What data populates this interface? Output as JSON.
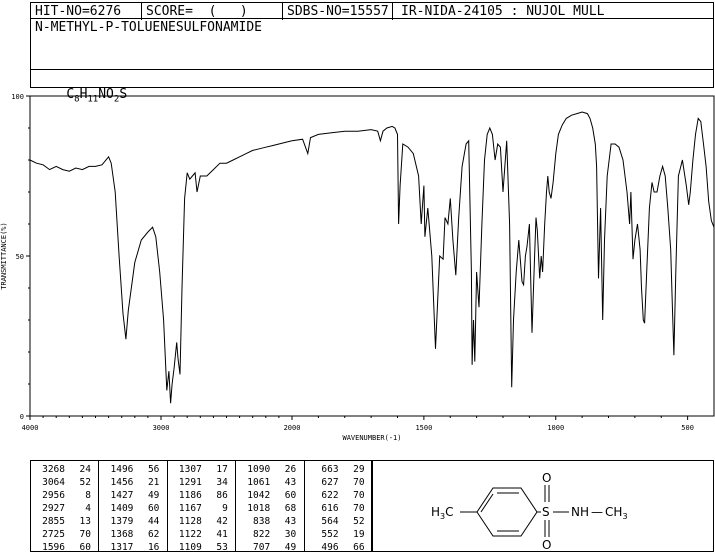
{
  "header": {
    "hit_no": "HIT-NO=6276",
    "score": "SCORE=  (   )",
    "sdbs_no": "SDBS-NO=15557",
    "ir_info": "IR-NIDA-24105 : NUJOL MULL",
    "compound_name": "N-METHYL-P-TOLUENESULFONAMIDE",
    "formula_parts": [
      "C",
      "8",
      "H",
      "11",
      "NO",
      "2",
      "S"
    ]
  },
  "chart_data": {
    "type": "line",
    "title": "",
    "xlabel": "WAVENUMBER(-1)",
    "ylabel": "TRANSMITTANCE(%)",
    "xlim": [
      4000,
      400
    ],
    "ylim": [
      0,
      100
    ],
    "x_ticks": [
      "4000",
      "3000",
      "2000",
      "1500",
      "1000",
      "500"
    ],
    "y_ticks": [
      "100",
      "50",
      "0"
    ],
    "grid": false,
    "series": [
      {
        "name": "",
        "points": [
          [
            4000,
            80
          ],
          [
            3950,
            79
          ],
          [
            3900,
            78.5
          ],
          [
            3850,
            77
          ],
          [
            3800,
            78
          ],
          [
            3750,
            77
          ],
          [
            3700,
            76.5
          ],
          [
            3650,
            77.5
          ],
          [
            3600,
            77
          ],
          [
            3550,
            78
          ],
          [
            3500,
            78
          ],
          [
            3450,
            78.5
          ],
          [
            3400,
            81
          ],
          [
            3380,
            79
          ],
          [
            3350,
            70
          ],
          [
            3320,
            50
          ],
          [
            3290,
            32
          ],
          [
            3268,
            24
          ],
          [
            3250,
            33
          ],
          [
            3200,
            48
          ],
          [
            3150,
            55
          ],
          [
            3100,
            57.5
          ],
          [
            3064,
            59
          ],
          [
            3040,
            56
          ],
          [
            3010,
            45
          ],
          [
            2980,
            30
          ],
          [
            2956,
            8
          ],
          [
            2940,
            14
          ],
          [
            2927,
            4
          ],
          [
            2915,
            10
          ],
          [
            2900,
            15
          ],
          [
            2880,
            23
          ],
          [
            2870,
            18
          ],
          [
            2855,
            13
          ],
          [
            2840,
            40
          ],
          [
            2820,
            68
          ],
          [
            2800,
            76
          ],
          [
            2780,
            74
          ],
          [
            2760,
            75
          ],
          [
            2740,
            76
          ],
          [
            2725,
            70
          ],
          [
            2700,
            75
          ],
          [
            2650,
            75
          ],
          [
            2600,
            77
          ],
          [
            2550,
            79
          ],
          [
            2500,
            79
          ],
          [
            2450,
            80
          ],
          [
            2400,
            81
          ],
          [
            2350,
            82
          ],
          [
            2300,
            83
          ],
          [
            2250,
            83.5
          ],
          [
            2200,
            84
          ],
          [
            2150,
            84.5
          ],
          [
            2100,
            85
          ],
          [
            2050,
            85.5
          ],
          [
            2000,
            86
          ],
          [
            1960,
            86.5
          ],
          [
            1940,
            82
          ],
          [
            1930,
            87
          ],
          [
            1900,
            88
          ],
          [
            1850,
            88.5
          ],
          [
            1800,
            89
          ],
          [
            1750,
            89
          ],
          [
            1700,
            89.5
          ],
          [
            1675,
            89
          ],
          [
            1665,
            86
          ],
          [
            1655,
            89
          ],
          [
            1640,
            90
          ],
          [
            1620,
            90.5
          ],
          [
            1610,
            90
          ],
          [
            1600,
            88
          ],
          [
            1596,
            60
          ],
          [
            1590,
            72
          ],
          [
            1580,
            85
          ],
          [
            1560,
            84
          ],
          [
            1540,
            82
          ],
          [
            1520,
            75
          ],
          [
            1510,
            60
          ],
          [
            1500,
            72
          ],
          [
            1496,
            56
          ],
          [
            1485,
            65
          ],
          [
            1470,
            50
          ],
          [
            1456,
            21
          ],
          [
            1440,
            50
          ],
          [
            1427,
            49
          ],
          [
            1420,
            62
          ],
          [
            1409,
            60
          ],
          [
            1400,
            68
          ],
          [
            1390,
            55
          ],
          [
            1379,
            44
          ],
          [
            1368,
            62
          ],
          [
            1355,
            78
          ],
          [
            1340,
            85
          ],
          [
            1330,
            86
          ],
          [
            1320,
            45
          ],
          [
            1317,
            16
          ],
          [
            1312,
            30
          ],
          [
            1307,
            17
          ],
          [
            1300,
            45
          ],
          [
            1291,
            34
          ],
          [
            1280,
            60
          ],
          [
            1270,
            80
          ],
          [
            1260,
            88
          ],
          [
            1250,
            90
          ],
          [
            1240,
            88
          ],
          [
            1230,
            80
          ],
          [
            1220,
            85
          ],
          [
            1210,
            84
          ],
          [
            1200,
            70
          ],
          [
            1186,
            86
          ],
          [
            1175,
            60
          ],
          [
            1167,
            9
          ],
          [
            1160,
            30
          ],
          [
            1150,
            45
          ],
          [
            1140,
            55
          ],
          [
            1128,
            42
          ],
          [
            1122,
            41
          ],
          [
            1115,
            50
          ],
          [
            1109,
            53
          ],
          [
            1100,
            60
          ],
          [
            1090,
            26
          ],
          [
            1080,
            50
          ],
          [
            1075,
            62
          ],
          [
            1070,
            58
          ],
          [
            1061,
            43
          ],
          [
            1055,
            50
          ],
          [
            1050,
            45
          ],
          [
            1042,
            60
          ],
          [
            1035,
            70
          ],
          [
            1030,
            75
          ],
          [
            1025,
            70
          ],
          [
            1018,
            68
          ],
          [
            1010,
            73
          ],
          [
            1000,
            82
          ],
          [
            990,
            88
          ],
          [
            975,
            91
          ],
          [
            960,
            93
          ],
          [
            940,
            94
          ],
          [
            920,
            94.5
          ],
          [
            900,
            95
          ],
          [
            880,
            94.5
          ],
          [
            870,
            93
          ],
          [
            860,
            90
          ],
          [
            850,
            85
          ],
          [
            845,
            78
          ],
          [
            838,
            43
          ],
          [
            830,
            65
          ],
          [
            822,
            30
          ],
          [
            815,
            55
          ],
          [
            805,
            75
          ],
          [
            790,
            85
          ],
          [
            775,
            85
          ],
          [
            760,
            84
          ],
          [
            745,
            80
          ],
          [
            730,
            70
          ],
          [
            720,
            60
          ],
          [
            715,
            70
          ],
          [
            707,
            49
          ],
          [
            700,
            55
          ],
          [
            690,
            60
          ],
          [
            680,
            52
          ],
          [
            675,
            40
          ],
          [
            668,
            30
          ],
          [
            663,
            29
          ],
          [
            655,
            45
          ],
          [
            645,
            65
          ],
          [
            635,
            73
          ],
          [
            627,
            70
          ],
          [
            622,
            70
          ],
          [
            616,
            70
          ],
          [
            605,
            75
          ],
          [
            595,
            78
          ],
          [
            585,
            75
          ],
          [
            575,
            65
          ],
          [
            564,
            52
          ],
          [
            558,
            35
          ],
          [
            552,
            19
          ],
          [
            545,
            45
          ],
          [
            535,
            75
          ],
          [
            520,
            80
          ],
          [
            505,
            72
          ],
          [
            496,
            66
          ],
          [
            490,
            70
          ],
          [
            480,
            80
          ],
          [
            470,
            88
          ],
          [
            460,
            93
          ],
          [
            450,
            92
          ],
          [
            440,
            85
          ],
          [
            430,
            78
          ],
          [
            420,
            67
          ],
          [
            410,
            61
          ],
          [
            400,
            59
          ]
        ]
      }
    ]
  },
  "peak_table": {
    "columns": [
      [
        [
          "3268",
          "24"
        ],
        [
          "3064",
          "52"
        ],
        [
          "2956",
          "8"
        ],
        [
          "2927",
          "4"
        ],
        [
          "2855",
          "13"
        ],
        [
          "2725",
          "70"
        ],
        [
          "1596",
          "60"
        ]
      ],
      [
        [
          "1496",
          "56"
        ],
        [
          "1456",
          "21"
        ],
        [
          "1427",
          "49"
        ],
        [
          "1409",
          "60"
        ],
        [
          "1379",
          "44"
        ],
        [
          "1368",
          "62"
        ],
        [
          "1317",
          "16"
        ]
      ],
      [
        [
          "1307",
          "17"
        ],
        [
          "1291",
          "34"
        ],
        [
          "1186",
          "86"
        ],
        [
          "1167",
          "9"
        ],
        [
          "1128",
          "42"
        ],
        [
          "1122",
          "41"
        ],
        [
          "1109",
          "53"
        ]
      ],
      [
        [
          "1090",
          "26"
        ],
        [
          "1061",
          "43"
        ],
        [
          "1042",
          "60"
        ],
        [
          "1018",
          "68"
        ],
        [
          "838",
          "43"
        ],
        [
          "822",
          "30"
        ],
        [
          "707",
          "49"
        ]
      ],
      [
        [
          "663",
          "29"
        ],
        [
          "627",
          "70"
        ],
        [
          "622",
          "70"
        ],
        [
          "616",
          "70"
        ],
        [
          "564",
          "52"
        ],
        [
          "552",
          "19"
        ],
        [
          "496",
          "66"
        ]
      ]
    ]
  },
  "structure": {
    "left_group": [
      "H",
      "3",
      "C"
    ],
    "sulfur": "S",
    "oxygen_top": "O",
    "oxygen_bottom": "O",
    "right_group": [
      "N",
      "H",
      "—",
      "C",
      "H",
      "3"
    ]
  }
}
